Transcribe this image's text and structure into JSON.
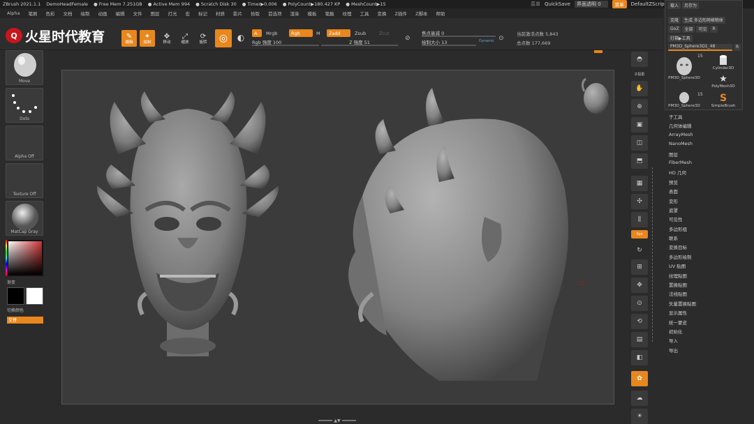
{
  "titlebar": {
    "app": "ZBrush 2021.1.1",
    "document": "DemoHeadFemale",
    "free_mem": "● Free Mem 7.251GB",
    "active_mem": "● Active Mem 994",
    "scratch_disk": "● Scratch Disk 30",
    "timer": "● Timer▶0.006",
    "polycount": "● PolyCount▶180.427 KP",
    "meshcount": "● MeshCount▶15"
  },
  "topright": {
    "label1": "菜单",
    "quicksave": "QuickSave",
    "transparency": "界面透明 0",
    "menus_btn": "菜单",
    "script": "DefaultZScript"
  },
  "menubar": [
    "Alpha",
    "笔刷",
    "色彩",
    "文档",
    "绘制",
    "动画",
    "编辑",
    "文件",
    "图层",
    "灯光",
    "宏",
    "标记",
    "材质",
    "影片",
    "拾取",
    "首选项",
    "渲染",
    "模板",
    "笔触",
    "纹理",
    "工具",
    "变换",
    "Z插件",
    "Z脚本",
    "帮助"
  ],
  "logo": {
    "mark": "Q",
    "text": "火星时代教育"
  },
  "toolbar": {
    "edit": "编辑",
    "draw": "绘制",
    "move": "移动",
    "scale": "缩放",
    "rotate": "旋转",
    "a": "A",
    "mrgb": "Mrgb",
    "rgb": "Rgb",
    "m": "M",
    "zadd": "Zadd",
    "zsub": "Zsub",
    "zcut": "Zcut",
    "rgb_intensity": "Rgb 强度 100",
    "z_intensity": "Z 强度 51",
    "focal_shift": "焦点衰减 0",
    "draw_size": "绘制大小 13",
    "dynamic": "Dynamic",
    "active_points": "当前激活点数 5,843",
    "total_points": "总点数 177,669"
  },
  "leftpanel": {
    "move": "Move",
    "dots": "Dots",
    "alpha": "Alpha Off",
    "texture": "Texture Off",
    "matcap": "MatCap Gray",
    "gradient": "渐变",
    "switch_color": "切换颜色",
    "alternate": "交替"
  },
  "rightshelf": [
    "分析",
    "子投影",
    "透视",
    "地面",
    "局部",
    "Xyz",
    "",
    "",
    "",
    "",
    "",
    "",
    "",
    "",
    "",
    ""
  ],
  "toolpanel": {
    "row1a": "载入",
    "row1b": "另存为",
    "row2a": "克隆",
    "row2b": "生成 多边形网格物体",
    "row3a": "GoZ",
    "row3b": "全部",
    "row3c": "可见",
    "row3d": "R",
    "row4a": "灯箱▶工具",
    "current_tool": "PM3D_Sphere3D1_48",
    "thumb1": "PM3D_Sphere3D",
    "thumb2": "Cylinder3D",
    "thumb3": "PolyMesh3D",
    "thumb4": "PM3D_Sphere3D",
    "thumb5": "SimpleBrush",
    "count1": "15",
    "count2": "15"
  },
  "toolmenu": [
    "子工具",
    "几何体编辑",
    "ArrayMesh",
    "NanoMesh",
    "图层",
    "FiberMesh",
    "HD 几何",
    "预览",
    "表面",
    "变形",
    "遮罩",
    "可见性",
    "多边形组",
    "联系",
    "变换目标",
    "多边形绘制",
    "UV 贴图",
    "纹理贴图",
    "置换贴图",
    "法线贴图",
    "矢量置换贴图",
    "显示属性",
    "统一蒙皮",
    "初始化",
    "导入",
    "导出"
  ],
  "colors": {
    "accent": "#e8871e",
    "viewport": "#3b3b3b",
    "panel": "#2d2d2d"
  }
}
